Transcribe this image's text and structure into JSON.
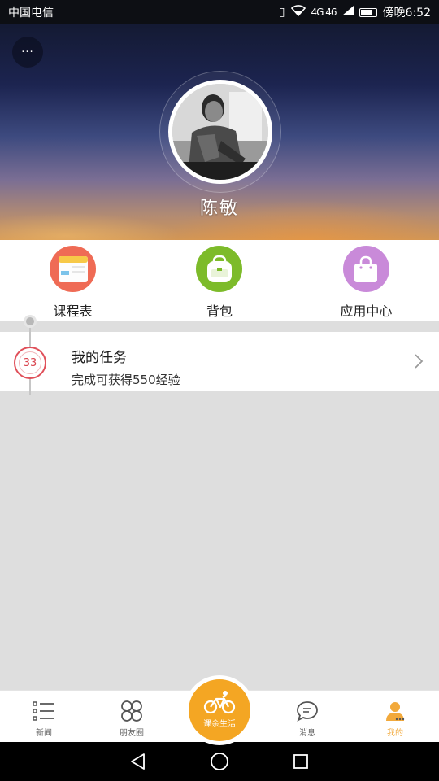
{
  "status_bar": {
    "carrier": "中国电信",
    "network": "4G 46",
    "time": "傍晚6:52"
  },
  "profile": {
    "more_label": "···",
    "name": "陈敏"
  },
  "shortcuts": [
    {
      "label": "课程表",
      "icon": "schedule-icon",
      "color": "#ef6b55"
    },
    {
      "label": "背包",
      "icon": "backpack-icon",
      "color": "#7dbb2a"
    },
    {
      "label": "应用中心",
      "icon": "shopping-bag-icon",
      "color": "#c98ad9"
    }
  ],
  "task": {
    "level": "33",
    "title": "我的任务",
    "subtitle": "完成可获得550经验"
  },
  "tabs": [
    {
      "label": "新闻",
      "icon": "list-icon",
      "active": false
    },
    {
      "label": "朋友圈",
      "icon": "clover-icon",
      "active": false
    },
    {
      "label": "课余生活",
      "icon": "bicycle-icon",
      "active": false
    },
    {
      "label": "消息",
      "icon": "chat-bubble-icon",
      "active": false
    },
    {
      "label": "我的",
      "icon": "person-icon",
      "active": true
    }
  ],
  "colors": {
    "accent": "#f4a623",
    "badge_red": "#e0505a"
  }
}
